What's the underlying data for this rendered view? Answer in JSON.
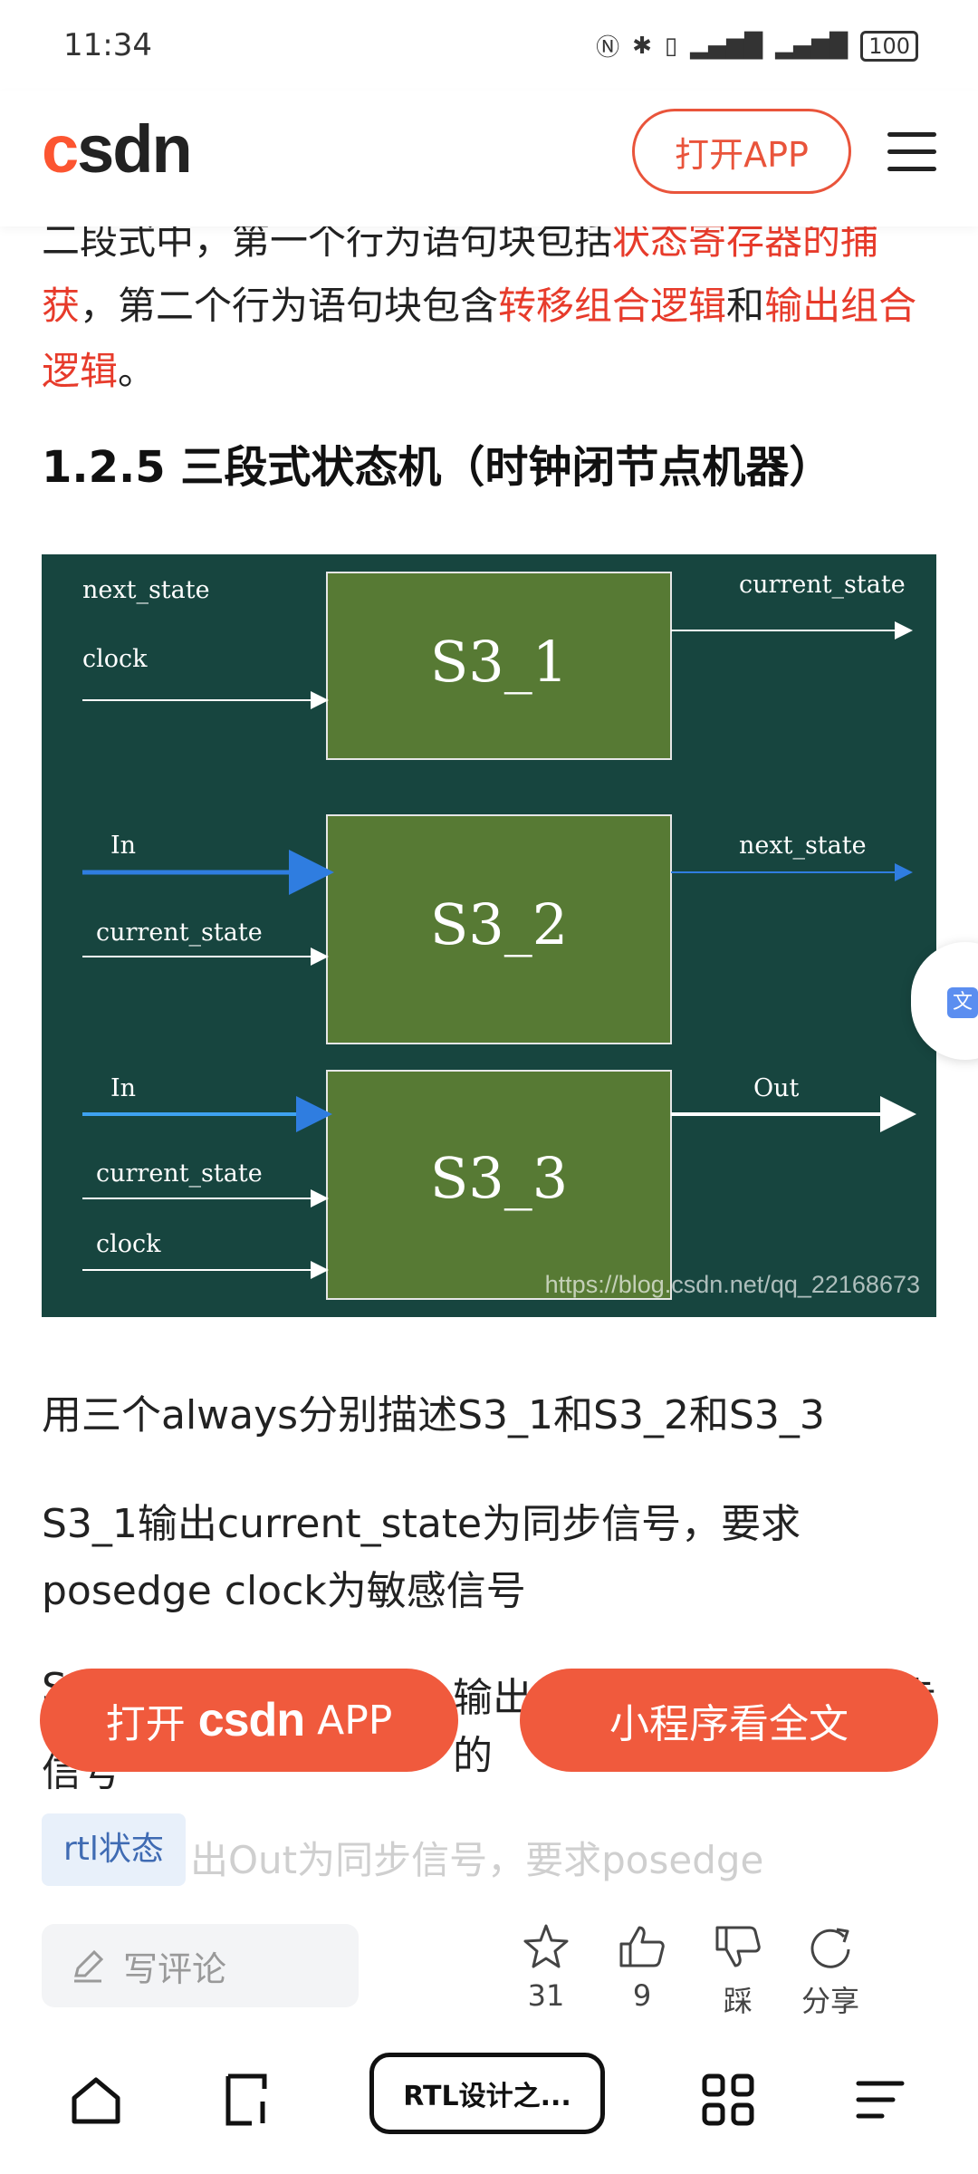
{
  "status_bar": {
    "time": "11:34",
    "battery": "100"
  },
  "header": {
    "logo": "csdn",
    "open_app_label": "打开APP"
  },
  "article": {
    "intro_segments": [
      {
        "text": "二段式中，第一个行为语句块包括",
        "highlight": false
      },
      {
        "text": "状态寄存器的捕获",
        "highlight": true
      },
      {
        "text": "，第二个行为语句块包含",
        "highlight": false
      },
      {
        "text": "转移组合逻辑",
        "highlight": true
      },
      {
        "text": "和",
        "highlight": false
      },
      {
        "text": "输出组合逻辑",
        "highlight": true
      },
      {
        "text": "。",
        "highlight": false
      }
    ],
    "heading": "1.2.5 三段式状态机（时钟闭节点机器）",
    "diagram": {
      "blocks": [
        "S3_1",
        "S3_2",
        "S3_3"
      ],
      "block1_inputs": [
        "next_state",
        "clock"
      ],
      "block1_output": "current_state",
      "block2_inputs": [
        "In",
        "current_state"
      ],
      "block2_output": "next_state",
      "block3_inputs": [
        "In",
        "current_state",
        "clock"
      ],
      "block3_output": "Out",
      "watermark": "https://blog.csdn.net/qq_22168673",
      "colors": {
        "background": "#17453f",
        "block": "#577a34",
        "blue_wire": "#2f7de0"
      }
    },
    "para1": "用三个always分别描述S3_1和S3_2和S3_3",
    "para2_line1": " S3_1输出current_state为同步信号，要求",
    "para2_line2": "posedge clock为敏感信号",
    "para3_left": "S",
    "para3_mid": "输出的",
    "para3_right": "步",
    "para3_line2": "信号",
    "faded_text": "出Out为同步信号，要求posedge"
  },
  "cta": {
    "left_prefix": "打开",
    "left_brand": "csdn",
    "left_suffix": "APP",
    "right_label": "小程序看全文"
  },
  "tag": "rtl状态",
  "action_bar": {
    "comment_placeholder": "写评论",
    "star_count": "31",
    "like_count": "9",
    "dislike_label": "踩",
    "share_label": "分享"
  },
  "nav": {
    "tab_label": "RTL设计之..."
  }
}
